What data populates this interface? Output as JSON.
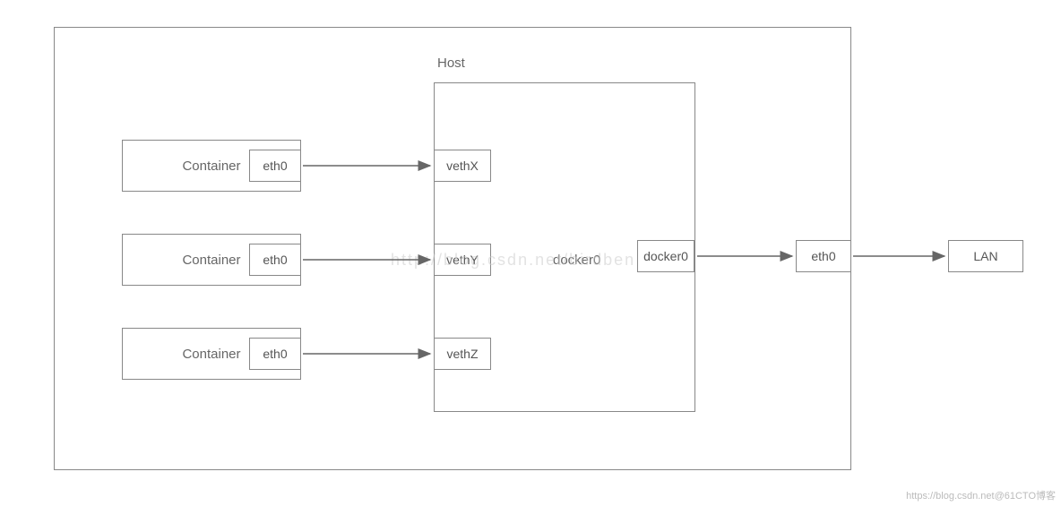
{
  "labels": {
    "host": "Host",
    "container": "Container",
    "eth0": "eth0",
    "vethX": "vethX",
    "vethY": "vethY",
    "vethZ": "vethZ",
    "docker0_inner": "docker0",
    "docker0_port": "docker0",
    "lan": "LAN",
    "watermark": "http://blog.csdn.net/birdben",
    "footer": "https://blog.csdn.net@61CTO博客"
  }
}
